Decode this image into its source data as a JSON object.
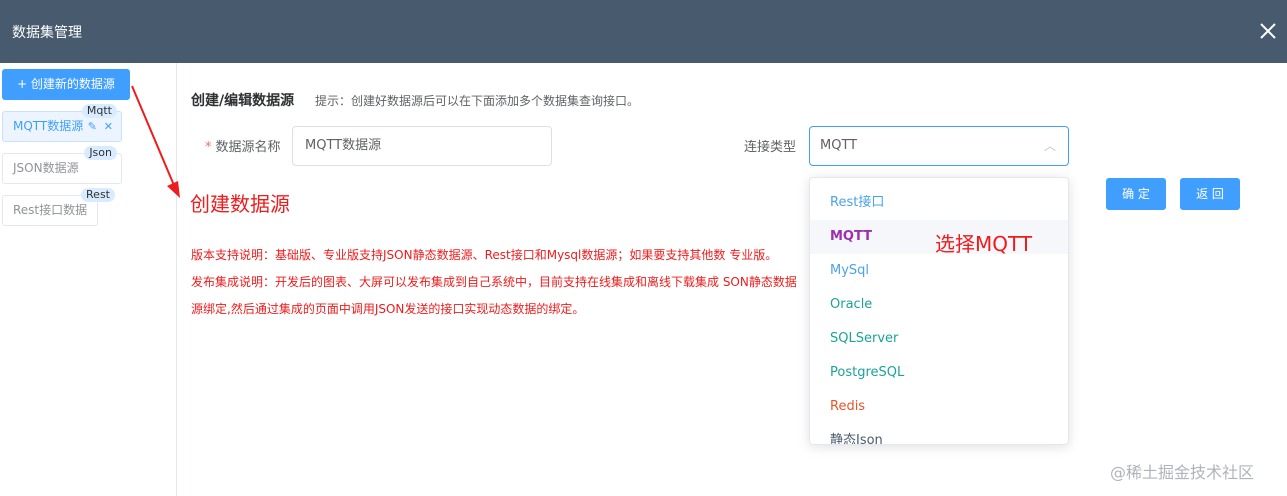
{
  "header": {
    "title": "数据集管理"
  },
  "sidebar": {
    "create_button": "+ 创建新的数据源",
    "sources": [
      {
        "label": "MQTT数据源",
        "tag": "Mqtt"
      },
      {
        "label": "JSON数据源",
        "tag": "Json"
      },
      {
        "label": "Rest接口数据",
        "tag": "Rest"
      }
    ]
  },
  "form": {
    "heading": "创建/编辑数据源",
    "hint": "提示：创建好数据源后可以在下面添加多个数据集查询接口。",
    "name_label": "数据源名称",
    "name_value": "MQTT数据源",
    "type_label": "连接类型",
    "type_value": "MQTT",
    "confirm_button": "确 定",
    "back_button": "返 回"
  },
  "dropdown": {
    "options": [
      "Rest接口",
      "MQTT",
      "MySql",
      "Oracle",
      "SQLServer",
      "PostgreSQL",
      "Redis",
      "静态Json"
    ]
  },
  "notes": {
    "line1": "版本支持说明：基础版、专业版支持JSON静态数据源、Rest接口和Mysql数据源；如果要支持其他数                                                                                    专业版。",
    "line2": "发布集成说明：开发后的图表、大屏可以发布集成到自己系统中，目前支持在线集成和离线下载集成                                                                          SON静态数据",
    "line3": "源绑定,然后通过集成的页面中调用JSON发送的接口实现动态数据的绑定。"
  },
  "annotations": {
    "create": "创建数据源",
    "select": "选择MQTT"
  },
  "watermark": "@稀土掘金技术社区",
  "colors": {
    "header_bg": "#475a6e",
    "primary": "#409eff",
    "annotation_red": "#ee1c1c",
    "selected_option": "#9b2fae",
    "redis_option": "#e6562a",
    "option_teal": "#1aa39a"
  }
}
